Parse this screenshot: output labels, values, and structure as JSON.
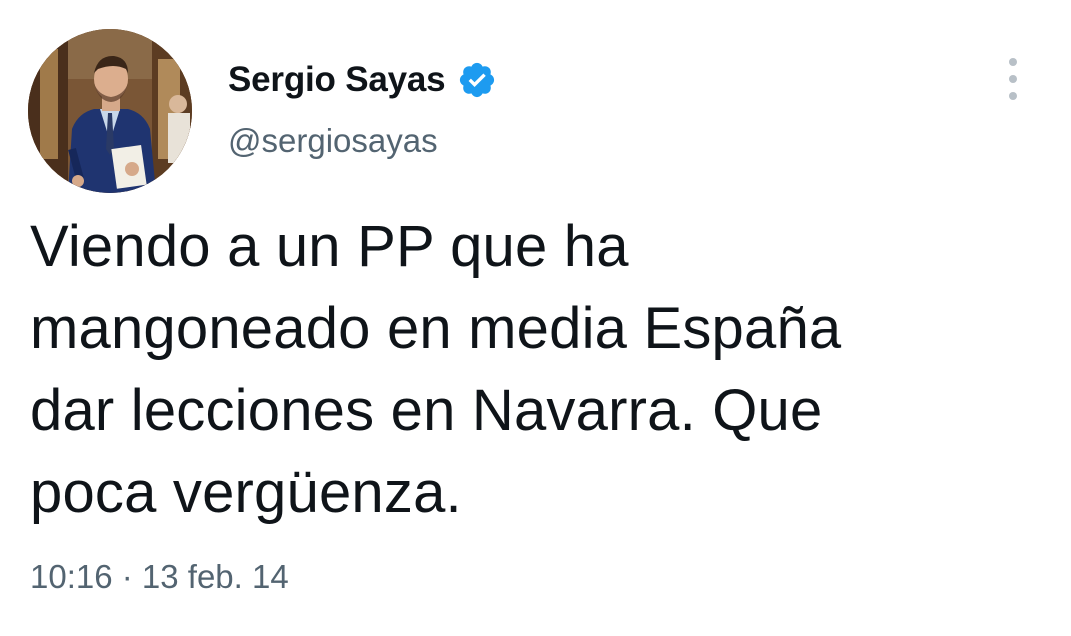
{
  "author": {
    "display_name": "Sergio Sayas",
    "handle": "@sergiosayas",
    "verified": true
  },
  "tweet": {
    "text": "Viendo a un PP que ha\nmangoneado en media España\ndar lecciones en Navarra. Que\npoca vergüenza.",
    "timestamp": "10:16 · 13 feb. 14"
  },
  "icons": {
    "verified": "verified-badge-icon",
    "more": "more-options-icon"
  },
  "colors": {
    "verified_blue": "#1d9bf0",
    "text_primary": "#0f1419",
    "text_secondary": "#536471"
  }
}
